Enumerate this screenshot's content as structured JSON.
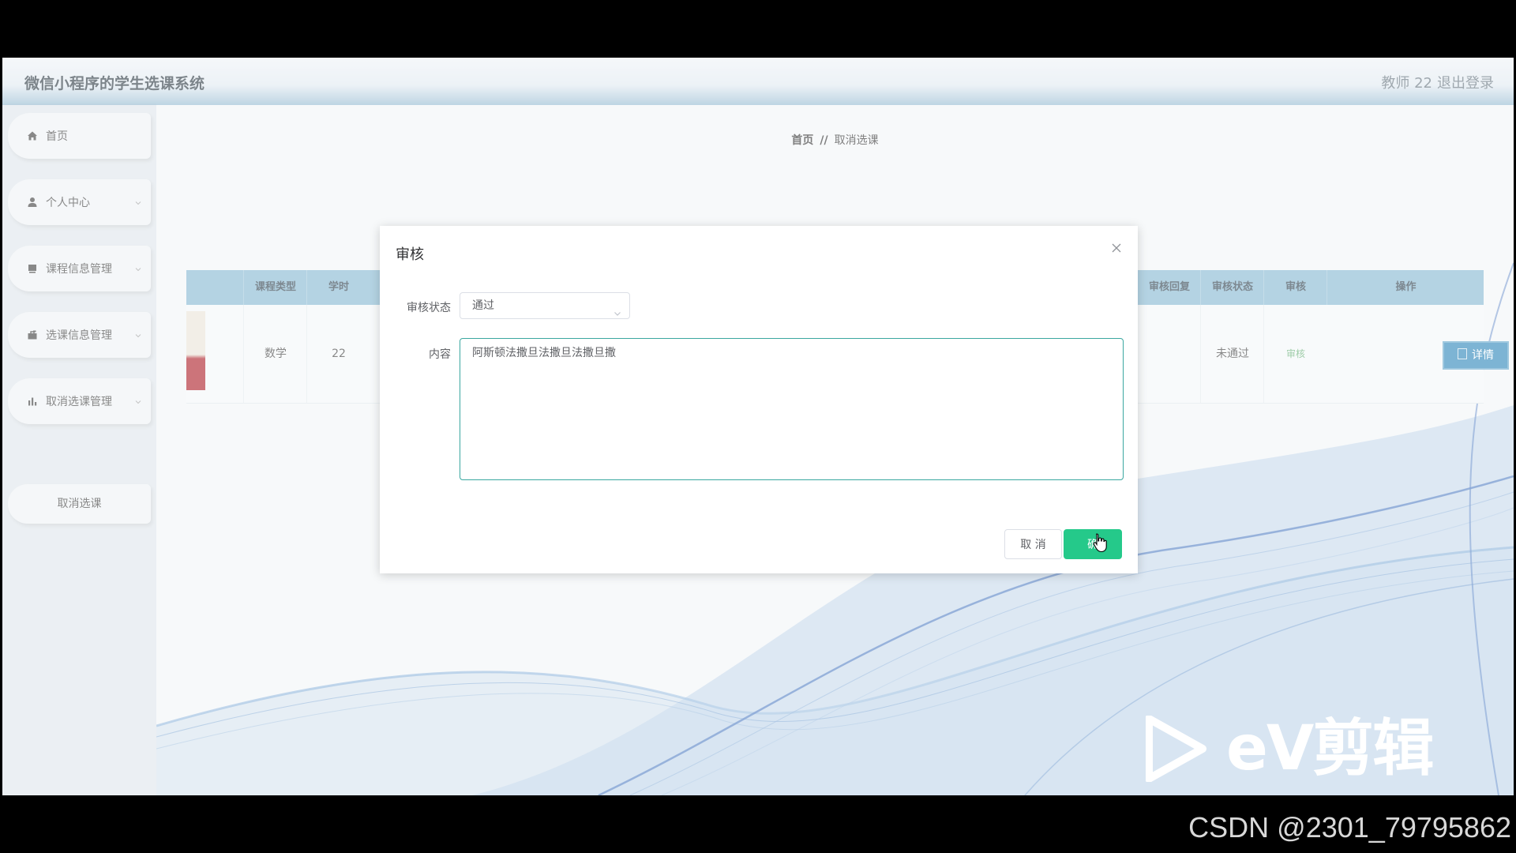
{
  "header": {
    "title": "微信小程序的学生选课系统",
    "user": "教师 22",
    "logout": "退出登录"
  },
  "sidebar": {
    "items": [
      {
        "label": "首页",
        "icon": "home-icon"
      },
      {
        "label": "个人中心",
        "icon": "user-icon"
      },
      {
        "label": "课程信息管理",
        "icon": "book-icon"
      },
      {
        "label": "选课信息管理",
        "icon": "briefcase-icon"
      },
      {
        "label": "取消选课管理",
        "icon": "chart-icon"
      }
    ],
    "sub_item": "取消选课"
  },
  "breadcrumb": {
    "home": "首页",
    "separator": "//",
    "current": "取消选课"
  },
  "table": {
    "headers": {
      "course_type": "课程类型",
      "hours": "学时",
      "audit_reply": "审核回复",
      "audit_status": "审核状态",
      "audit": "审核",
      "actions": "操作"
    },
    "row": {
      "course_type": "数学",
      "hours": "22",
      "audit_status": "未通过",
      "audit_link": "审核",
      "detail_button": "详情"
    }
  },
  "modal": {
    "title": "审核",
    "status_label": "审核状态",
    "status_value": "通过",
    "content_label": "内容",
    "content_value": "阿斯顿法撒旦法撒旦法撒旦撒",
    "cancel_label": "取 消",
    "ok_label": "确"
  },
  "watermark": {
    "text": "eV剪辑",
    "footer": "CSDN @2301_79795862"
  },
  "colors": {
    "accent": "#25c98a",
    "header_blue": "#7fb3cf",
    "detail_blue": "#1f7fb6"
  }
}
